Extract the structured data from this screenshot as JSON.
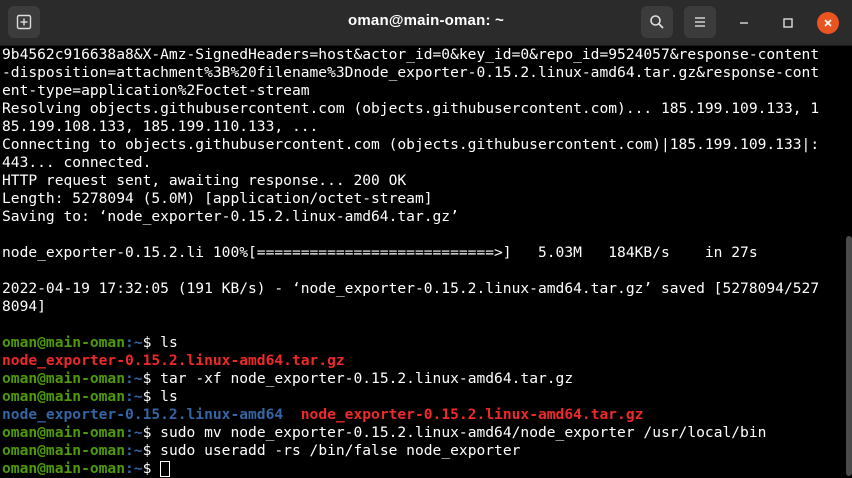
{
  "window": {
    "title": "oman@main-oman: ~"
  },
  "terminal": {
    "lines": [
      "9b4562c916638a8&X-Amz-SignedHeaders=host&actor_id=0&key_id=0&repo_id=9524057&response-content",
      "-disposition=attachment%3B%20filename%3Dnode_exporter-0.15.2.linux-amd64.tar.gz&response-cont",
      "ent-type=application%2Foctet-stream",
      "Resolving objects.githubusercontent.com (objects.githubusercontent.com)... 185.199.109.133, 1",
      "85.199.108.133, 185.199.110.133, ...",
      "Connecting to objects.githubusercontent.com (objects.githubusercontent.com)|185.199.109.133|:",
      "443... connected.",
      "HTTP request sent, awaiting response... 200 OK",
      "Length: 5278094 (5.0M) [application/octet-stream]",
      "Saving to: ‘node_exporter-0.15.2.linux-amd64.tar.gz’",
      "",
      "node_exporter-0.15.2.li 100%[===========================>]   5.03M   184KB/s    in 27s",
      "",
      "2022-04-19 17:32:05 (191 KB/s) - ‘node_exporter-0.15.2.linux-amd64.tar.gz’ saved [5278094/527",
      "8094]",
      ""
    ],
    "prompt_user": "oman@main-oman",
    "prompt_path": ":~",
    "prompt_sym": "$ ",
    "cmd_ls1": "ls",
    "out_ls1_file": "node_exporter-0.15.2.linux-amd64.tar.gz",
    "cmd_tar": "tar -xf node_exporter-0.15.2.linux-amd64.tar.gz",
    "cmd_ls2": "ls",
    "out_ls2_dir": "node_exporter-0.15.2.linux-amd64",
    "out_ls2_sep": "  ",
    "out_ls2_file": "node_exporter-0.15.2.linux-amd64.tar.gz",
    "cmd_mv": "sudo mv node_exporter-0.15.2.linux-amd64/node_exporter /usr/local/bin",
    "cmd_useradd": "sudo useradd -rs /bin/false node_exporter",
    "cmd_current": ""
  },
  "icons": {
    "new_tab": "new-tab-icon",
    "search": "search-icon",
    "menu": "hamburger-menu-icon",
    "minimize": "minimize-icon",
    "maximize": "maximize-icon",
    "close": "close-icon"
  },
  "colors": {
    "titlebar": "#2b2b2b",
    "background": "#000000",
    "prompt_user": "#4e9a06",
    "prompt_path": "#3465a4",
    "archive_file": "#ef2929",
    "directory": "#3465a4",
    "close_button": "#e95420"
  }
}
